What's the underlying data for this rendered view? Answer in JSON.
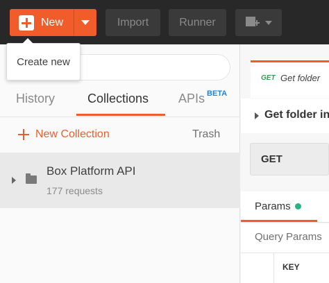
{
  "toolbar": {
    "new_label": "New",
    "import_label": "Import",
    "runner_label": "Runner",
    "workspace_icon": "new-window-icon"
  },
  "tooltip": {
    "text": "Create new"
  },
  "sidebar": {
    "search_placeholder": "",
    "tabs": [
      {
        "label": "History",
        "active": false
      },
      {
        "label": "Collections",
        "active": true
      },
      {
        "label": "APIs",
        "active": false,
        "badge": "BETA"
      }
    ],
    "new_collection_label": "New Collection",
    "trash_label": "Trash",
    "collections": [
      {
        "name": "Box Platform API",
        "count": "177 requests"
      }
    ]
  },
  "request": {
    "tab_method": "GET",
    "tab_name": "Get folder",
    "title": "Get folder in",
    "method": "GET",
    "params_tab": "Params",
    "query_params_label": "Query Params",
    "key_header": "KEY"
  },
  "colors": {
    "accent": "#f05d2a",
    "toolbar_bg": "#282828",
    "beta_badge": "#1a86d8",
    "get_method": "#2e9e4f",
    "params_dot": "#26b47f"
  }
}
